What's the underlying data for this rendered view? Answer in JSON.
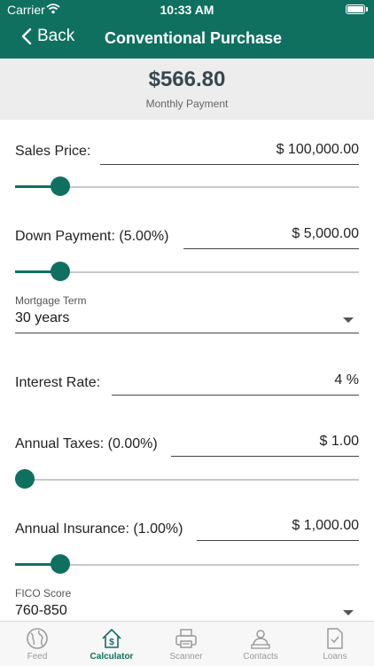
{
  "status_bar": {
    "carrier": "Carrier",
    "time": "10:33 AM"
  },
  "nav": {
    "back_label": "Back",
    "title": "Conventional Purchase"
  },
  "summary": {
    "amount": "$566.80",
    "label": "Monthly Payment"
  },
  "fields": {
    "sales_price": {
      "label": "Sales Price:",
      "value": "$ 100,000.00",
      "slider_fraction": 0.11
    },
    "down_payment": {
      "label": "Down Payment: (5.00%)",
      "value": "$ 5,000.00",
      "slider_fraction": 0.11
    },
    "mortgage_term": {
      "label": "Mortgage Term",
      "value": "30 years"
    },
    "interest_rate": {
      "label": "Interest Rate:",
      "value": "4 %"
    },
    "annual_taxes": {
      "label": "Annual Taxes: (0.00%)",
      "value": "$ 1.00",
      "slider_fraction": 0.0
    },
    "annual_insurance": {
      "label": "Annual Insurance: (1.00%)",
      "value": "$ 1,000.00",
      "slider_fraction": 0.11
    },
    "fico_score": {
      "label": "FICO Score",
      "value": "760-850"
    }
  },
  "tabs": [
    {
      "label": "Feed",
      "icon": "globe-icon",
      "active": false
    },
    {
      "label": "Calculator",
      "icon": "house-dollar-icon",
      "active": true
    },
    {
      "label": "Scanner",
      "icon": "scanner-icon",
      "active": false
    },
    {
      "label": "Contacts",
      "icon": "contacts-icon",
      "active": false
    },
    {
      "label": "Loans",
      "icon": "document-check-icon",
      "active": false
    }
  ],
  "colors": {
    "brand": "#0f7060",
    "summary_bg": "#ededed",
    "amount_text": "#37474f",
    "tab_inactive": "#9a9a9a"
  }
}
